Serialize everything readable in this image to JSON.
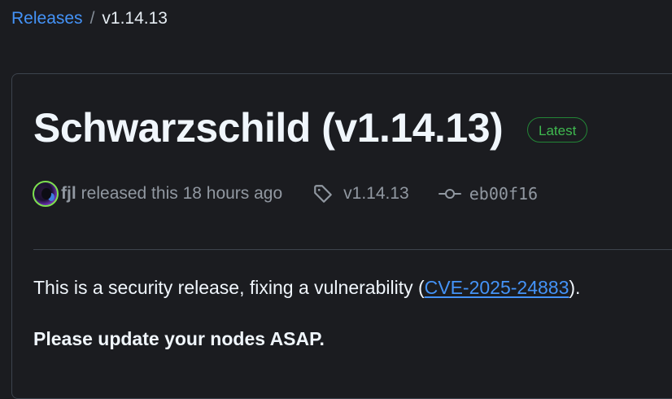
{
  "breadcrumb": {
    "parent_label": "Releases",
    "separator": "/",
    "current_label": "v1.14.13"
  },
  "release": {
    "title": "Schwarzschild (v1.14.13)",
    "badge": "Latest",
    "author": "fjl",
    "released_text": "released this 18 hours ago",
    "tag": "v1.14.13",
    "commit": "eb00f16",
    "body": {
      "line1_prefix": "This is a security release, fixing a vulnerability (",
      "cve_link": "CVE-2025-24883",
      "line1_suffix": ").",
      "line2": "Please update your nodes ASAP."
    }
  },
  "icons": {
    "tag": "tag-icon",
    "commit": "git-commit-icon",
    "avatar": "user-avatar"
  },
  "colors": {
    "background": "#1b1c20",
    "link": "#4493f8",
    "badge_green": "#3fb950",
    "muted_text": "#9198a1",
    "border": "#3d444d"
  }
}
